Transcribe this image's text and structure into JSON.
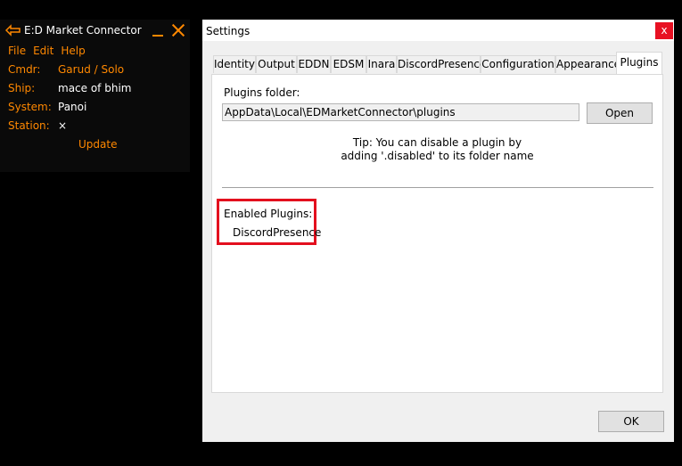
{
  "edmc": {
    "title": "E:D Market Connector",
    "menu": [
      "File",
      "Edit",
      "Help"
    ],
    "rows": [
      {
        "label": "Cmdr:",
        "value": "Garud / Solo"
      },
      {
        "label": "Ship:",
        "value": "mace of bhim"
      },
      {
        "label": "System:",
        "value": "Panoi"
      },
      {
        "label": "Station:",
        "value": "×"
      }
    ],
    "update_label": "Update",
    "colors": {
      "accent": "#ff8800",
      "background": "#0a0a0a"
    }
  },
  "settings": {
    "title": "Settings",
    "close_glyph": "x",
    "tabs": [
      {
        "label": "Identity"
      },
      {
        "label": "Output"
      },
      {
        "label": "EDDN"
      },
      {
        "label": "EDSM"
      },
      {
        "label": "Inara"
      },
      {
        "label": "DiscordPresence"
      },
      {
        "label": "Configuration"
      },
      {
        "label": "Appearance"
      },
      {
        "label": "Plugins",
        "active": true
      }
    ],
    "plugins": {
      "folder_label": "Plugins folder:",
      "folder_value": "AppData\\Local\\EDMarketConnector\\plugins",
      "open_label": "Open",
      "tip_line1": "Tip: You can disable a plugin by",
      "tip_line2": "adding '.disabled' to its folder name",
      "enabled_label": "Enabled Plugins:",
      "enabled_list": [
        "DiscordPresence"
      ]
    },
    "ok_label": "OK",
    "colors": {
      "close": "#e81123",
      "highlight": "#e3101e"
    }
  }
}
